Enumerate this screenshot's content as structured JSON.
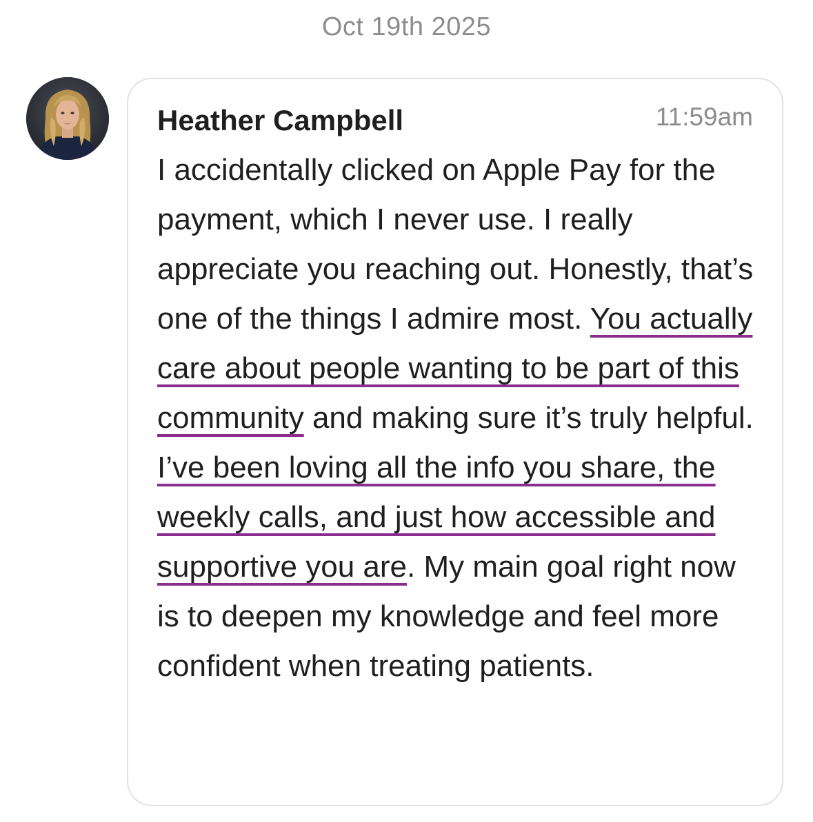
{
  "date_divider": "Oct 19th 2025",
  "message": {
    "sender": "Heather Campbell",
    "time": "11:59am",
    "text_intro": "I accidentally clicked on Apple Pay for the payment, which I never use. I really appreciate you reaching out. Honestly, that’s one of the things I admire most. ",
    "text_highlight_1": "You actually care about people wanting to be part of this community",
    "text_mid": " and making sure it’s truly helpful.",
    "text_highlight_2": "I’ve been loving all the info you share, the weekly calls, and just how accessible and supportive you are",
    "text_end": ". My main goal right now is to deepen my knowledge and feel more confident when treating patients."
  },
  "colors": {
    "underline": "#8b2c8e",
    "muted_text": "#8c8c8c",
    "bubble_border": "#e2e2e2"
  },
  "icons": {
    "avatar": "profile-photo"
  }
}
